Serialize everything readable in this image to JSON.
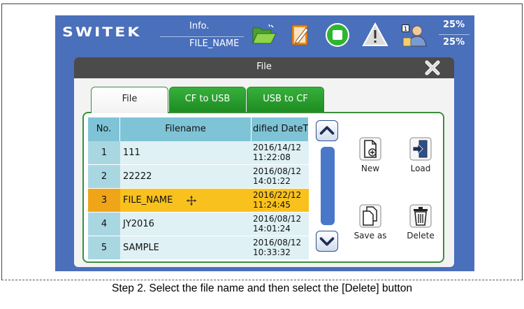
{
  "header": {
    "logo": "SWITEK",
    "info_label": "Info.",
    "info_value": "FILE_NAME",
    "percent_top": "25%",
    "percent_bottom": "25%",
    "icons": [
      "folder-open-icon",
      "edit-icon",
      "stop-icon",
      "warning-icon",
      "user-icon"
    ]
  },
  "dialog": {
    "title": "File",
    "tabs": [
      "File",
      "CF to USB",
      "USB to CF"
    ],
    "table": {
      "columns": [
        "No.",
        "Filename",
        "dified DateTi"
      ],
      "rows": [
        {
          "no": "1",
          "name": "111",
          "date": "2016/14/12",
          "time": "11:22:08"
        },
        {
          "no": "2",
          "name": "22222",
          "date": "2016/08/12",
          "time": "14:01:22"
        },
        {
          "no": "3",
          "name": "FILE_NAME",
          "date": "2016/22/12",
          "time": "11:24:45"
        },
        {
          "no": "4",
          "name": "JY2016",
          "date": "2016/08/12",
          "time": "14:01:24"
        },
        {
          "no": "5",
          "name": "SAMPLE",
          "date": "2016/08/12",
          "time": "10:33:32"
        }
      ]
    },
    "actions": {
      "new": "New",
      "load": "Load",
      "save_as": "Save as",
      "delete": "Delete"
    }
  },
  "caption": "Step 2. Select the file name and then select the [Delete] button"
}
